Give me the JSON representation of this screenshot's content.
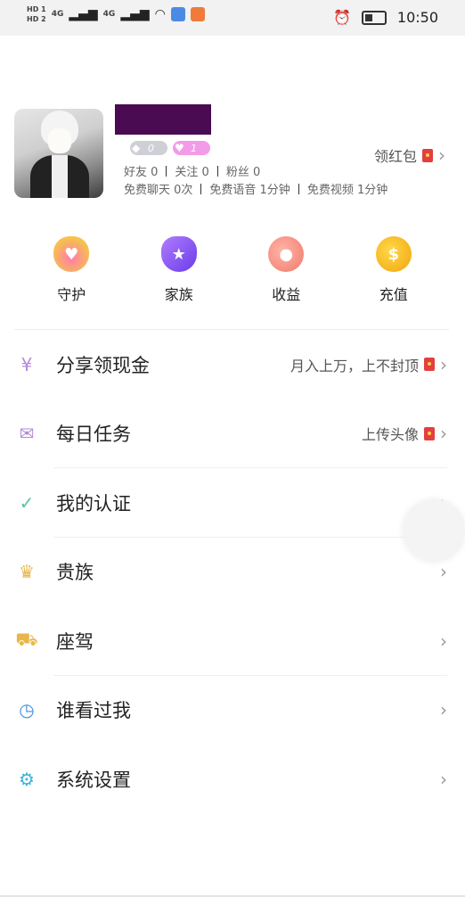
{
  "status_bar": {
    "hd1": "HD 1",
    "hd2": "HD 2",
    "net1": "4G",
    "net2": "4G",
    "time": "10:50"
  },
  "profile": {
    "diamond_level": "0",
    "heart_level": "1",
    "friends": "好友 0",
    "follow": "关注 0",
    "fans": "粉丝 0",
    "free_chat": "免费聊天 0次",
    "free_voice": "免费语音 1分钟",
    "free_video": "免费视频 1分钟",
    "redpack_label": "领红包"
  },
  "quick_actions": [
    {
      "label": "守护",
      "icon": "guard-heart-icon"
    },
    {
      "label": "家族",
      "icon": "family-shield-icon"
    },
    {
      "label": "收益",
      "icon": "piggy-bank-icon"
    },
    {
      "label": "充值",
      "icon": "coin-icon"
    }
  ],
  "menu": [
    {
      "label": "分享领现金",
      "right": "月入上万，上不封顶",
      "icon": "money-bag-icon",
      "color": "#b28ad8"
    },
    {
      "label": "每日任务",
      "right": "上传头像",
      "icon": "task-envelope-icon",
      "color": "#b28ad8"
    },
    {
      "label": "我的认证",
      "right": "",
      "icon": "verified-badge-icon",
      "color": "#5ac2a0"
    },
    {
      "label": "贵族",
      "right": "",
      "icon": "crown-icon",
      "color": "#e8b64a"
    },
    {
      "label": "座驾",
      "right": "",
      "icon": "car-icon",
      "color": "#e8b64a"
    },
    {
      "label": "谁看过我",
      "right": "",
      "icon": "visitor-icon",
      "color": "#3b8ee0"
    },
    {
      "label": "系统设置",
      "right": "",
      "icon": "settings-gear-icon",
      "color": "#3bb3d8"
    }
  ]
}
